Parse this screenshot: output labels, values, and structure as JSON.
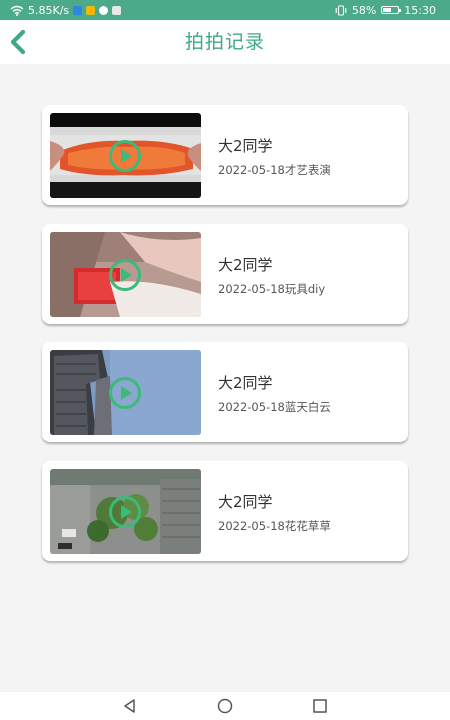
{
  "status_bar": {
    "speed": "5.85K/s",
    "battery": "58%",
    "time": "15:30",
    "battery_level": 0.58,
    "bg_color": "#4aaa8a"
  },
  "header": {
    "title": "拍拍记录",
    "accent_color": "#3fa985"
  },
  "records": [
    {
      "user": "大2同学",
      "meta": "2022-05-18才艺表演",
      "thumb_icon": "play-icon"
    },
    {
      "user": "大2同学",
      "meta": "2022-05-18玩具diy",
      "thumb_icon": "play-icon"
    },
    {
      "user": "大2同学",
      "meta": "2022-05-18蓝天白云",
      "thumb_icon": "play-icon"
    },
    {
      "user": "大2同学",
      "meta": "2022-05-18花花草草",
      "thumb_icon": "play-icon"
    }
  ],
  "nav_bar": {
    "icons": [
      "back-triangle-icon",
      "home-circle-icon",
      "recents-square-icon"
    ]
  }
}
